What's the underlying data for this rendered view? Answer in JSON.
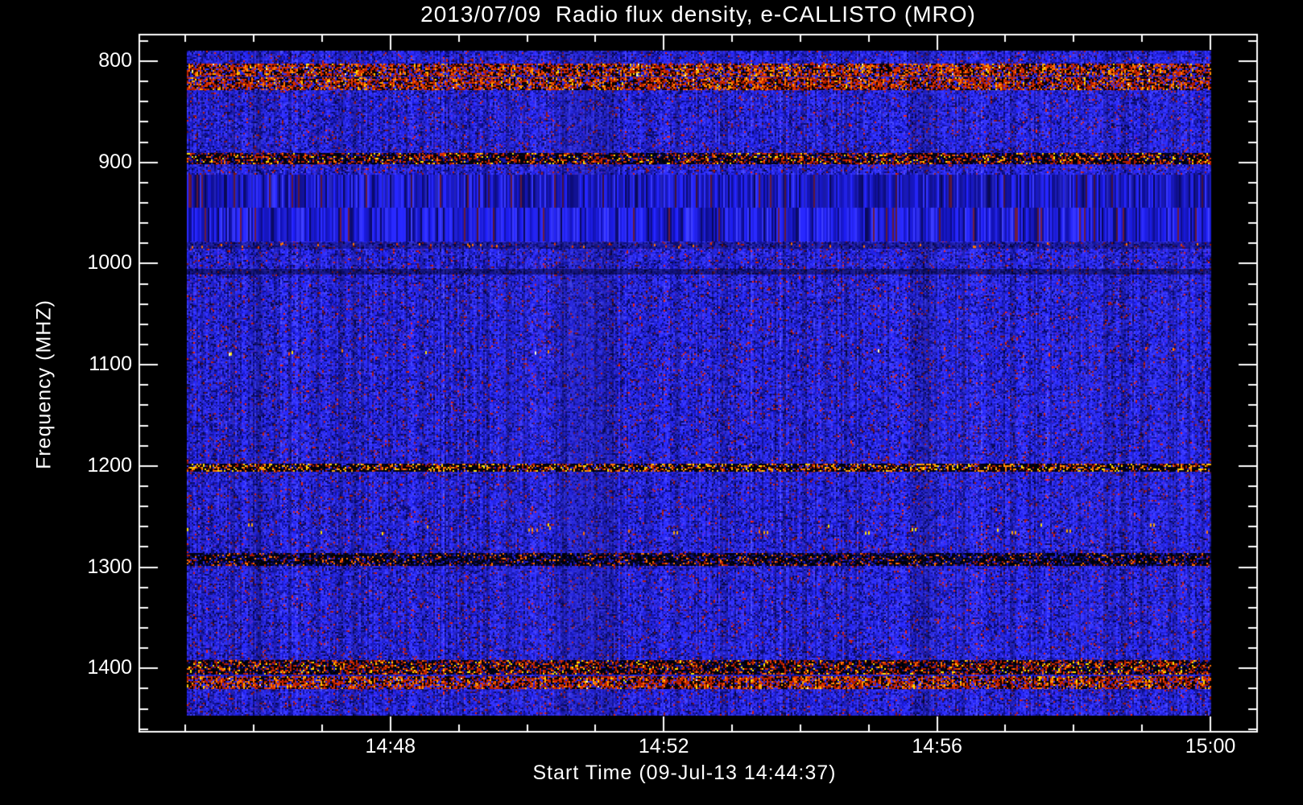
{
  "title": "2013/07/09  Radio flux density, e-CALLISTO (MRO)",
  "chart_data": {
    "type": "heatmap",
    "subtype": "radio-spectrogram",
    "title": "2013/07/09  Radio flux density, e-CALLISTO (MRO)",
    "xlabel": "Start Time (09-Jul-13 14:44:37)",
    "ylabel": "Frequency (MHZ)",
    "x_ticks": [
      "14:48",
      "14:52",
      "14:56",
      "15:00"
    ],
    "x_tick_minutes_before_end": [
      12,
      8,
      4,
      0
    ],
    "x_minor_tick_interval": "1 min",
    "x_data_range": [
      "14:45:00",
      "15:00:00"
    ],
    "y_ticks": [
      800,
      900,
      1000,
      1100,
      1200,
      1300,
      1400
    ],
    "y_minor_step_mhz": 20,
    "y_data_range_mhz": [
      790,
      1446
    ],
    "y_axis_increases_downward": true,
    "grid": false,
    "legend": "none",
    "background": "#000000",
    "bands": [
      {
        "f1": 802,
        "f2": 814,
        "style": "rfi_bright",
        "label": "RFI band ~808 MHz"
      },
      {
        "f1": 816,
        "f2": 828,
        "style": "rfi_bright",
        "label": "RFI band ~822 MHz"
      },
      {
        "f1": 891,
        "f2": 901,
        "style": "rfi_dark_speckle",
        "label": "RFI band ~896 MHz"
      },
      {
        "f1": 912,
        "f2": 945,
        "style": "striped_smooth",
        "label": "smooth banded region 912-945 MHz"
      },
      {
        "f1": 945,
        "f2": 978,
        "style": "striped_strong",
        "label": "strong striped region 945-978 MHz"
      },
      {
        "f1": 979,
        "f2": 985,
        "style": "speckle_sparse_orange",
        "label": "sparse orange speckle line ~982 MHz"
      },
      {
        "f1": 1005,
        "f2": 1011,
        "style": "faint_dark",
        "label": "faint dark line ~1008 MHz"
      },
      {
        "f1": 1082,
        "f2": 1092,
        "style": "speckle_sparse_bright",
        "label": "sparse bright dots ~1087 MHz"
      },
      {
        "f1": 1198,
        "f2": 1205,
        "style": "rfi_speckle_line",
        "label": "speckled RFI line ~1202 MHz"
      },
      {
        "f1": 1256,
        "f2": 1269,
        "style": "speckle_sparse_yellow",
        "label": "sparse yellow clusters ~1262 MHz"
      },
      {
        "f1": 1286,
        "f2": 1298,
        "style": "rfi_dark",
        "label": "dark RFI band ~1292 MHz"
      },
      {
        "f1": 1392,
        "f2": 1405,
        "style": "rfi_dark_speckle",
        "label": "RFI band ~1398 MHz"
      },
      {
        "f1": 1408,
        "f2": 1420,
        "style": "rfi_bright",
        "label": "bright RFI band ~1414 MHz"
      }
    ],
    "palette": {
      "axis": "#ffffff",
      "text": "#ffffff",
      "noise_blues": [
        "#2020d8",
        "#2c2cf0",
        "#3a3aff",
        "#1414a8",
        "#0d0d7c",
        "#090950"
      ],
      "noise_purple": "#4c20b4",
      "noise_maroon": "#701420",
      "noise_red": "#c81e0a",
      "rfi_red": "#e03400",
      "rfi_red_dark": "#b01c00",
      "rfi_orange": "#ff7400",
      "rfi_amber": "#ffaa00",
      "rfi_yellow": "#ffe400",
      "rfi_white": "#ffffc8",
      "rfi_black": "#000006",
      "band_dark": "#06041e",
      "stripe_palette": [
        "#1616bc",
        "#2222e6",
        "#3232ff",
        "#0e0e90",
        "#0a0a60",
        "#5c1836"
      ]
    }
  }
}
